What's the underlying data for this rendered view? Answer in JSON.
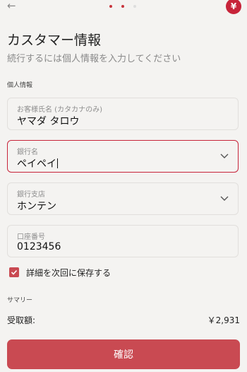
{
  "header": {
    "back_icon": "back-arrow-icon",
    "brand_icon_glyph": "¥",
    "steps_total": 3,
    "steps_active": 2
  },
  "page": {
    "title": "カスタマー情報",
    "subtitle": "続行するには個人情報を入力してください"
  },
  "personal": {
    "section_label": "個人情報",
    "name": {
      "label": "お客様氏名 (カタカナのみ)",
      "value": "ヤマダ タロウ"
    },
    "bank": {
      "label": "銀行名",
      "value": "ペイペイ"
    },
    "branch": {
      "label": "銀行支店",
      "value": "ホンテン"
    },
    "account": {
      "label": "口座番号",
      "value": "0123456"
    }
  },
  "save_details": {
    "label": "詳細を次回に保存する",
    "checked": true
  },
  "summary": {
    "section_label": "サマリー",
    "received_label": "受取額:",
    "received_value": "￥2,931"
  },
  "confirm_button": {
    "label": "確認"
  },
  "colors": {
    "accent": "#c7243a",
    "button": "#c94a52",
    "background": "#f4f3f1"
  }
}
